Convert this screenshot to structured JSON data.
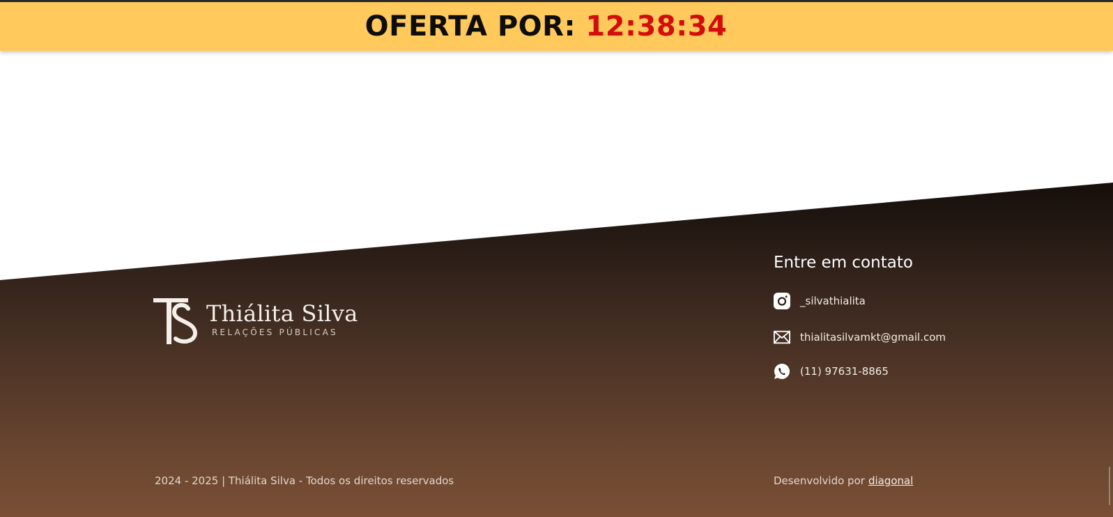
{
  "offer_bar": {
    "label": "OFERTA POR:",
    "timer": "12:38:34",
    "colors": {
      "background": "#ffc95c",
      "label": "#0d0d0d",
      "timer": "#d30c0c"
    }
  },
  "footer": {
    "logo": {
      "monogram": "TS",
      "name": "Thiálita Silva",
      "subtitle": "RELAÇÕES PÚBLICAS"
    },
    "contact": {
      "title": "Entre em contato",
      "items": [
        {
          "icon": "instagram-icon",
          "text": "_silvathialita"
        },
        {
          "icon": "email-icon",
          "text": "thialitasilvamkt@gmail.com"
        },
        {
          "icon": "whatsapp-icon",
          "text": "(11) 97631-8865"
        }
      ]
    },
    "copyright": "2024 - 2025 | Thiálita Silva - Todos os direitos reservados",
    "developed_by": {
      "prefix": "Desenvolvido por",
      "link": "diagonal"
    },
    "colors": {
      "gradient_top": "#17100c",
      "gradient_bottom": "#7a4f35",
      "text": "#f3ece6"
    }
  }
}
